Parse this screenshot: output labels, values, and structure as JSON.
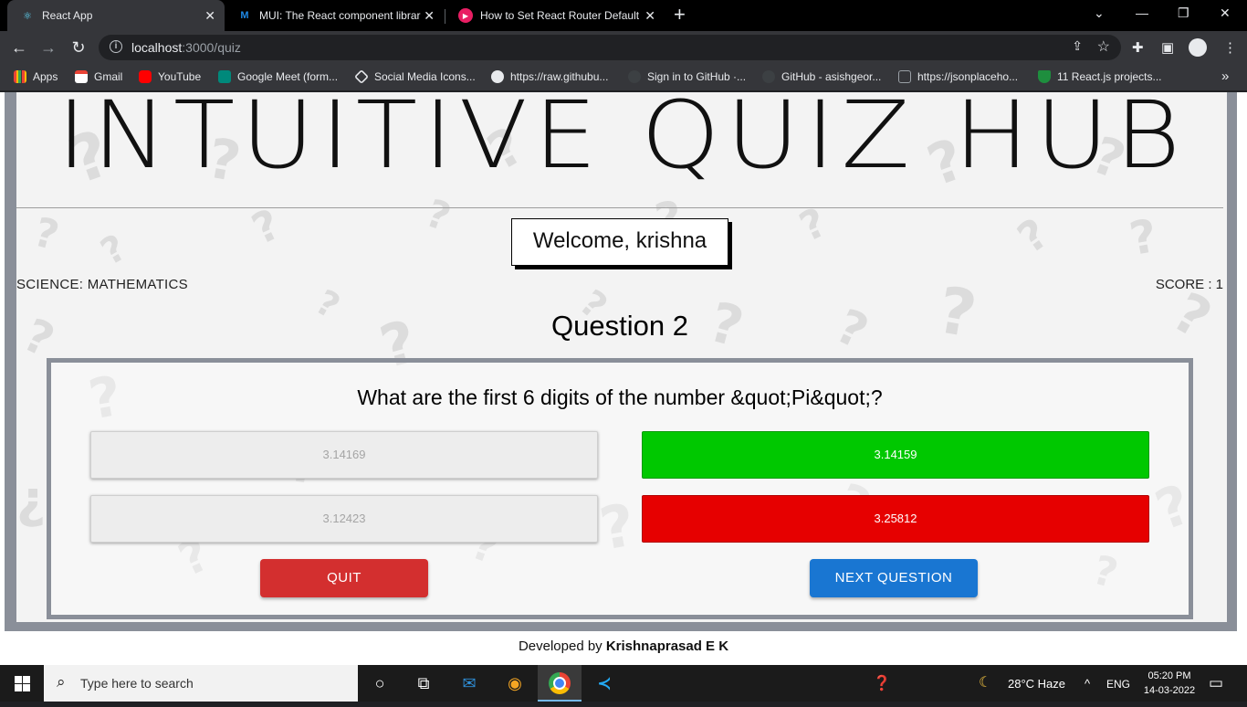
{
  "browser": {
    "tabs": [
      {
        "title": "React App"
      },
      {
        "title": "MUI: The React component librar"
      },
      {
        "title": "How to Set React Router Default"
      }
    ],
    "url_host": "localhost",
    "url_path": ":3000/quiz",
    "bookmarks": [
      {
        "label": "Apps",
        "icon": "apps-grid-icon"
      },
      {
        "label": "Gmail",
        "icon": "gmail-icon"
      },
      {
        "label": "YouTube",
        "icon": "youtube-icon"
      },
      {
        "label": "Google Meet (form...",
        "icon": "meet-icon"
      },
      {
        "label": "Social Media Icons...",
        "icon": "codepen-icon"
      },
      {
        "label": "https://raw.githubu...",
        "icon": "github-icon"
      },
      {
        "label": "Sign in to GitHub ·...",
        "icon": "github-icon"
      },
      {
        "label": "GitHub - asishgeor...",
        "icon": "github-icon"
      },
      {
        "label": "https://jsonplaceho...",
        "icon": "json-icon"
      },
      {
        "label": "11 React.js projects...",
        "icon": "graduation-cap-icon"
      }
    ],
    "more_bookmarks": "»"
  },
  "page": {
    "title": "INTUITIVE QUIZ HUB",
    "welcome": "Welcome, krishna",
    "category": "SCIENCE: MATHEMATICS",
    "score": "SCORE : 1",
    "question_number": "Question 2",
    "question_text": "What are the first 6 digits of the number &quot;Pi&quot;?",
    "options": [
      {
        "label": "3.14169",
        "state": "disabled"
      },
      {
        "label": "3.14159",
        "state": "correct"
      },
      {
        "label": "3.12423",
        "state": "disabled"
      },
      {
        "label": "3.25812",
        "state": "wrong"
      }
    ],
    "quit_label": "QUIT",
    "next_label": "NEXT QUESTION",
    "footer_prefix": "Developed by ",
    "footer_author": "Krishnaprasad E K"
  },
  "taskbar": {
    "search_placeholder": "Type here to search",
    "weather": "28°C  Haze",
    "language": "ENG",
    "time": "05:20 PM",
    "date": "14-03-2022"
  },
  "colors": {
    "correct": "#00c800",
    "wrong": "#e60000",
    "quit": "#d32f2f",
    "next": "#1976d2"
  }
}
